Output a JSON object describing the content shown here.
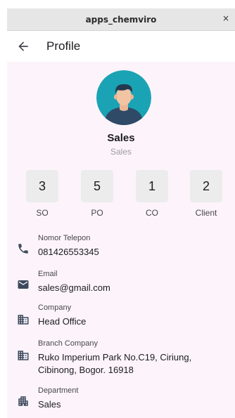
{
  "window": {
    "title": "apps_chemviro",
    "close_label": "×"
  },
  "appbar": {
    "back_icon": "arrow-back-icon",
    "title": "Profile"
  },
  "profile": {
    "name": "Sales",
    "role": "Sales"
  },
  "stats": [
    {
      "value": "3",
      "label": "SO"
    },
    {
      "value": "5",
      "label": "PO"
    },
    {
      "value": "1",
      "label": "CO"
    },
    {
      "value": "2",
      "label": "Client"
    }
  ],
  "info": [
    {
      "icon": "phone-icon",
      "label": "Nomor Telepon",
      "value": "081426553345"
    },
    {
      "icon": "email-icon",
      "label": "Email",
      "value": "sales@gmail.com"
    },
    {
      "icon": "business-icon",
      "label": "Company",
      "value": "Head Office"
    },
    {
      "icon": "domain-icon",
      "label": "Branch Company",
      "value": "Ruko Imperium Park No.C19, Ciriung, Cibinong, Bogor. 16918"
    },
    {
      "icon": "apartment-icon",
      "label": "Department",
      "value": "Sales"
    }
  ],
  "colors": {
    "content_background": "#fcf4fa",
    "avatar_background": "#1aa3b4",
    "icon": "#3c4a5c"
  }
}
